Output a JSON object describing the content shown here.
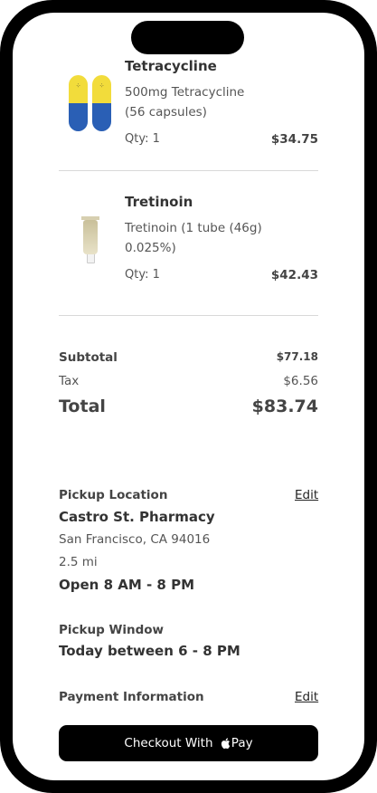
{
  "cart": {
    "items": [
      {
        "name": "Tetracycline",
        "description_line1": "500mg Tetracycline",
        "description_line2": "(56 capsules)",
        "qty": "Qty: 1",
        "price": "$34.75",
        "icon": "capsule-icon"
      },
      {
        "name": "Tretinoin",
        "description_line1": "Tretinoin (1 tube (46g)",
        "description_line2": "0.025%)",
        "qty": "Qty: 1",
        "price": "$42.43",
        "icon": "tube-icon"
      }
    ]
  },
  "summary": {
    "subtotal_label": "Subtotal",
    "subtotal_value": "$77.18",
    "tax_label": "Tax",
    "tax_value": "$6.56",
    "total_label": "Total",
    "total_value": "$83.74"
  },
  "pickup": {
    "location_label": "Pickup Location",
    "edit_label": "Edit",
    "pharmacy_name": "Castro St. Pharmacy",
    "address": "San Francisco, CA 94016",
    "distance": "2.5 mi",
    "hours": "Open 8 AM - 8 PM",
    "window_label": "Pickup Window",
    "window_value": "Today between 6 - 8 PM"
  },
  "payment": {
    "label": "Payment Information",
    "edit_label": "Edit"
  },
  "checkout": {
    "label_prefix": "Checkout With ",
    "label_suffix": "Pay"
  },
  "colors": {
    "capsule_top": "#f2dc3b",
    "capsule_bottom": "#2a5fb5",
    "button_bg": "#000000"
  }
}
